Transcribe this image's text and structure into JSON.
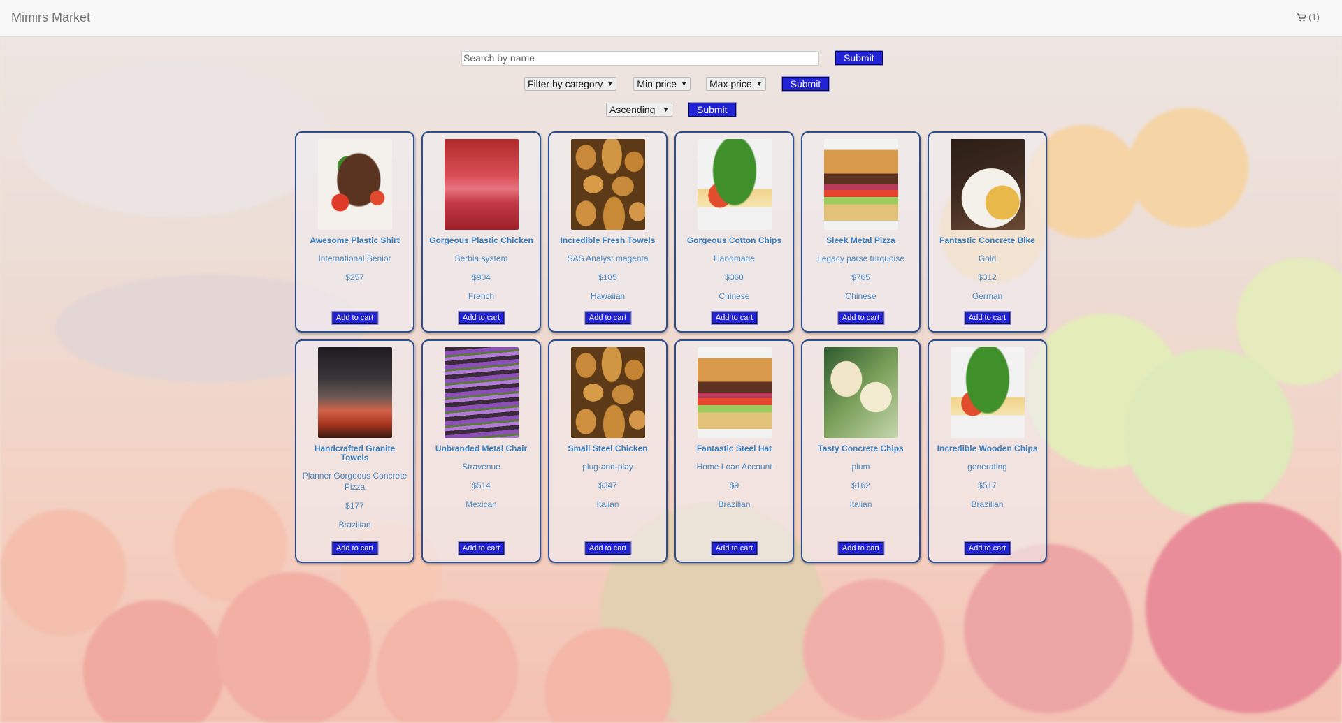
{
  "header": {
    "brand": "Mimirs Market",
    "cart_count": "(1)"
  },
  "search": {
    "placeholder": "Search by name",
    "submit_label": "Submit"
  },
  "filters": {
    "category_label": "Filter by category",
    "min_price_label": "Min price",
    "max_price_label": "Max price",
    "submit_label": "Submit"
  },
  "sort": {
    "order_label": "Ascending",
    "submit_label": "Submit"
  },
  "add_to_cart_label": "Add to cart",
  "products": [
    {
      "name": "Awesome Plastic Shirt",
      "desc": "International Senior",
      "price": "$257",
      "cuisine": "",
      "image": "steak"
    },
    {
      "name": "Gorgeous Plastic Chicken",
      "desc": "Serbia system",
      "price": "$904",
      "cuisine": "French",
      "image": "pink"
    },
    {
      "name": "Incredible Fresh Towels",
      "desc": "SAS Analyst magenta",
      "price": "$185",
      "cuisine": "Hawaiian",
      "image": "nuts"
    },
    {
      "name": "Gorgeous Cotton Chips",
      "desc": "Handmade",
      "price": "$368",
      "cuisine": "Chinese",
      "image": "sandwich"
    },
    {
      "name": "Sleek Metal Pizza",
      "desc": "Legacy parse turquoise",
      "price": "$765",
      "cuisine": "Chinese",
      "image": "burger"
    },
    {
      "name": "Fantastic Concrete Bike",
      "desc": "Gold",
      "price": "$312",
      "cuisine": "German",
      "image": "plate"
    },
    {
      "name": "Handcrafted Granite Towels",
      "desc": "Planner Gorgeous Concrete Pizza",
      "price": "$177",
      "cuisine": "Brazilian",
      "image": "sunset"
    },
    {
      "name": "Unbranded Metal Chair",
      "desc": "Stravenue",
      "price": "$514",
      "cuisine": "Mexican",
      "image": "purple"
    },
    {
      "name": "Small Steel Chicken",
      "desc": "plug-and-play",
      "price": "$347",
      "cuisine": "Italian",
      "image": "nuts"
    },
    {
      "name": "Fantastic Steel Hat",
      "desc": "Home Loan Account",
      "price": "$9",
      "cuisine": "Brazilian",
      "image": "burger"
    },
    {
      "name": "Tasty Concrete Chips",
      "desc": "plum",
      "price": "$162",
      "cuisine": "Italian",
      "image": "dessert"
    },
    {
      "name": "Incredible Wooden Chips",
      "desc": "generating",
      "price": "$517",
      "cuisine": "Brazilian",
      "image": "sandwich"
    }
  ]
}
